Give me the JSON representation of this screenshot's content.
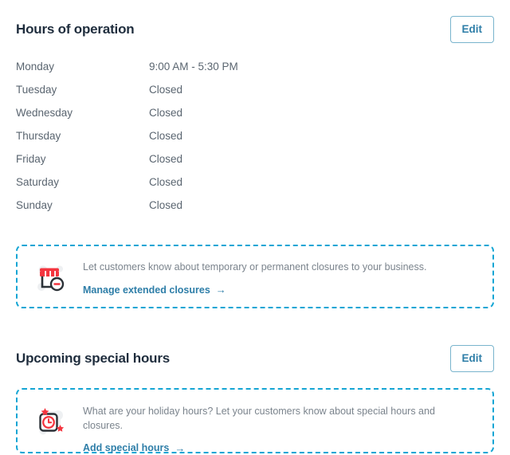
{
  "hours_section": {
    "title": "Hours of operation",
    "edit_label": "Edit",
    "rows": [
      {
        "day": "Monday",
        "value": "9:00 AM - 5:30 PM"
      },
      {
        "day": "Tuesday",
        "value": "Closed"
      },
      {
        "day": "Wednesday",
        "value": "Closed"
      },
      {
        "day": "Thursday",
        "value": "Closed"
      },
      {
        "day": "Friday",
        "value": "Closed"
      },
      {
        "day": "Saturday",
        "value": "Closed"
      },
      {
        "day": "Sunday",
        "value": "Closed"
      }
    ]
  },
  "closures_callout": {
    "icon": "storefront-closed-icon",
    "text": "Let customers know about temporary or permanent closures to your business.",
    "link_label": "Manage extended closures",
    "link_arrow": "→"
  },
  "special_hours_section": {
    "title": "Upcoming special hours",
    "edit_label": "Edit"
  },
  "special_hours_callout": {
    "icon": "holiday-clock-icon",
    "text": "What are your holiday hours? Let your customers know about special hours and closures.",
    "link_label": "Add special hours",
    "link_arrow": "→"
  },
  "colors": {
    "dashed_border": "#14a5d4",
    "link": "#2e7ea8",
    "button_border": "#79b4cd",
    "title": "#1f2d3d",
    "body_text": "#5a6570",
    "muted_text": "#7b848d",
    "icon_red": "#f4353f",
    "icon_dark": "#2b3137"
  }
}
